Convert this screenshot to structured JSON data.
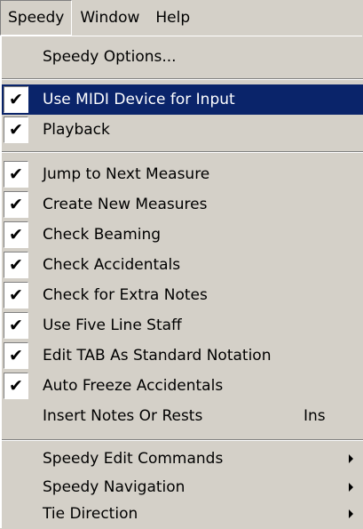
{
  "menubar": {
    "items": [
      {
        "label": "Speedy"
      },
      {
        "label": "Window"
      },
      {
        "label": "Help"
      }
    ]
  },
  "menu": {
    "options_label": "Speedy Options...",
    "use_midi_label": "Use MIDI Device for Input",
    "playback_label": "Playback",
    "jump_label": "Jump to Next Measure",
    "create_label": "Create New Measures",
    "beaming_label": "Check Beaming",
    "accidentals_label": "Check Accidentals",
    "extra_notes_label": "Check for Extra Notes",
    "five_line_label": "Use Five Line Staff",
    "edit_tab_label": "Edit TAB As Standard Notation",
    "auto_freeze_label": "Auto Freeze Accidentals",
    "insert_label": "Insert Notes Or Rests",
    "insert_shortcut": "Ins",
    "edit_commands_label": "Speedy Edit Commands",
    "navigation_label": "Speedy Navigation",
    "tie_direction_label": "Tie Direction",
    "check_glyph": "✔"
  },
  "colors": {
    "menu_bg": "#d4d0c8",
    "highlight_bg": "#0a246a",
    "highlight_text": "#ffffff"
  }
}
